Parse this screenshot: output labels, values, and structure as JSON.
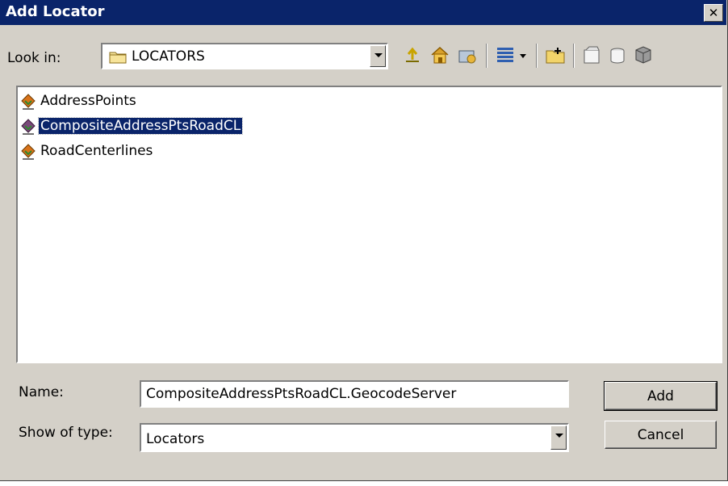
{
  "window": {
    "title": "Add Locator",
    "close_glyph": "✕"
  },
  "toolbar": {
    "look_in_label": "Look in:",
    "look_in_value": "LOCATORS",
    "icons": [
      "up-one-level-icon",
      "home-icon",
      "connect-folder-icon",
      "view-details-icon",
      "view-dropdown-icon",
      "new-folder-icon",
      "new-file-icon",
      "new-object-icon",
      "catalog-options-icon"
    ]
  },
  "files": [
    {
      "name": "AddressPoints",
      "selected": false
    },
    {
      "name": "CompositeAddressPtsRoadCL",
      "selected": true
    },
    {
      "name": "RoadCenterlines",
      "selected": false
    }
  ],
  "form": {
    "name_label": "Name:",
    "name_value": "CompositeAddressPtsRoadCL.GeocodeServer",
    "type_label": "Show of type:",
    "type_value": "Locators"
  },
  "buttons": {
    "add": "Add",
    "cancel": "Cancel"
  },
  "colors": {
    "title_bg": "#0a246a",
    "dialog_bg": "#d4d0c8",
    "selection": "#0a246a"
  }
}
